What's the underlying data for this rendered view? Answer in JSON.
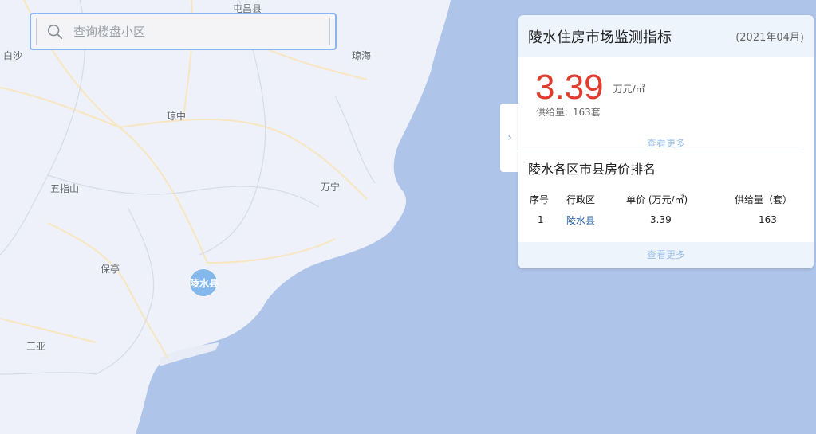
{
  "search": {
    "placeholder": "查询楼盘小区"
  },
  "map": {
    "colors": {
      "land": "#eef1f9",
      "sea": "#aec4e8",
      "road": "#f7e6bf",
      "boundary": "#d6dbe6"
    },
    "cities": [
      {
        "key": "tunchang",
        "name": "屯昌县"
      },
      {
        "key": "baisha",
        "name": "白沙"
      },
      {
        "key": "qionghai",
        "name": "琼海"
      },
      {
        "key": "qiongzhong",
        "name": "琼中"
      },
      {
        "key": "wuzhishan",
        "name": "五指山"
      },
      {
        "key": "wanning",
        "name": "万宁"
      },
      {
        "key": "baoting",
        "name": "保亭"
      },
      {
        "key": "sanya",
        "name": "三亚"
      }
    ],
    "marker": {
      "label": "陵水县",
      "color": "#7fb6ea"
    }
  },
  "panel": {
    "title": "陵水住房市场监测指标",
    "date": "(2021年04月)",
    "price": "3.39",
    "price_unit": "万元/㎡",
    "supply_label": "供给量:",
    "supply_value": "163套",
    "more_label": "查看更多",
    "ranking_title": "陵水各区市县房价排名",
    "columns": [
      "序号",
      "行政区",
      "单价 (万元/㎡)",
      "供给量（套）"
    ],
    "rows": [
      {
        "index": "1",
        "district": "陵水县",
        "price": "3.39",
        "supply": "163"
      }
    ],
    "more_label_2": "查看更多",
    "accent_color": "#e03b2c"
  }
}
